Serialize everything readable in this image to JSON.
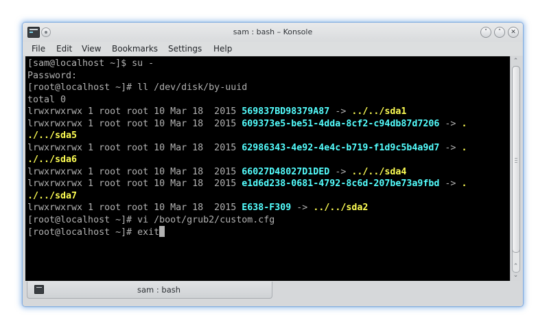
{
  "window": {
    "title": "sam : bash – Konsole",
    "buttons": {
      "minimize": "˅",
      "maximize": "˄",
      "close": "✕"
    }
  },
  "menu": [
    "File",
    "Edit",
    "View",
    "Bookmarks",
    "Settings",
    "Help"
  ],
  "terminal": {
    "lines": [
      [
        {
          "t": "[sam@localhost ~]$ su -"
        }
      ],
      [
        {
          "t": "Password:"
        }
      ],
      [
        {
          "t": "[root@localhost ~]# ll /dev/disk/by-uuid"
        }
      ],
      [
        {
          "t": "total 0"
        }
      ],
      [
        {
          "t": "lrwxrwxrwx 1 root root 10 Mar 18  2015 "
        },
        {
          "t": "569837BD98379A87",
          "c": "uuid"
        },
        {
          "t": " -> "
        },
        {
          "t": "../../sda1",
          "c": "link"
        }
      ],
      [
        {
          "t": "lrwxrwxrwx 1 root root 10 Mar 18  2015 "
        },
        {
          "t": "609373e5-be51-4dda-8cf2-c94db87d7206",
          "c": "uuid"
        },
        {
          "t": " -> "
        },
        {
          "t": ".",
          "c": "link"
        }
      ],
      [
        {
          "t": "./../sda5",
          "c": "link"
        }
      ],
      [
        {
          "t": "lrwxrwxrwx 1 root root 10 Mar 18  2015 "
        },
        {
          "t": "62986343-4e92-4e4c-b719-f1d9c5b4a9d7",
          "c": "uuid"
        },
        {
          "t": " -> "
        },
        {
          "t": ".",
          "c": "link"
        }
      ],
      [
        {
          "t": "./../sda6",
          "c": "link"
        }
      ],
      [
        {
          "t": "lrwxrwxrwx 1 root root 10 Mar 18  2015 "
        },
        {
          "t": "66027D48027D1DED",
          "c": "uuid"
        },
        {
          "t": " -> "
        },
        {
          "t": "../../sda4",
          "c": "link"
        }
      ],
      [
        {
          "t": "lrwxrwxrwx 1 root root 10 Mar 18  2015 "
        },
        {
          "t": "e1d6d238-0681-4792-8c6d-207be73a9fbd",
          "c": "uuid"
        },
        {
          "t": " -> "
        },
        {
          "t": ".",
          "c": "link"
        }
      ],
      [
        {
          "t": "./../sda7",
          "c": "link"
        }
      ],
      [
        {
          "t": "lrwxrwxrwx 1 root root 10 Mar 18  2015 "
        },
        {
          "t": "E638-F309",
          "c": "uuid"
        },
        {
          "t": " -> "
        },
        {
          "t": "../../sda2",
          "c": "link"
        }
      ],
      [
        {
          "t": "[root@localhost ~]# vi /boot/grub2/custom.cfg"
        }
      ],
      [
        {
          "t": "[root@localhost ~]# exit"
        }
      ]
    ],
    "colors": {
      "background": "#000000",
      "text": "#b2b2b2",
      "uuid": "#54ffff",
      "link": "#ffff54"
    }
  },
  "tabs": [
    {
      "label": "sam : bash",
      "active": true
    }
  ]
}
